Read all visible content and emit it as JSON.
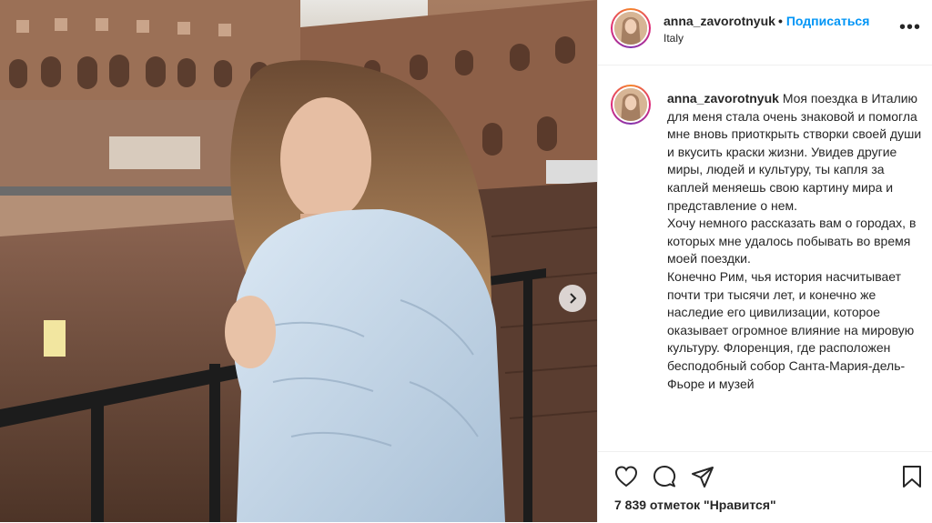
{
  "post": {
    "username": "anna_zavorotnyuk",
    "follow_label": "Подписаться",
    "separator": "•",
    "location": "Italy",
    "more_label": "•••"
  },
  "caption": {
    "username": "anna_zavorotnyuk",
    "text": "Моя поездка в Италию для меня стала очень знаковой и помогла мне вновь приоткрыть створки своей души и вкусить краски жизни. Увидев другие миры, людей и культуру, ты капля за каплей меняешь свою картину мира и представление о нем.\nХочу немного рассказать вам о городах, в которых мне удалось побывать во время моей поездки.\nКонечно Рим, чья история насчитывает почти три тысячи лет, и конечно же наследие его цивилизации, которое оказывает огромное влияние на мировую культуру. Флоренция, где расположен бесподобный собор Санта-Мария-дель-Фьоре и музей"
  },
  "actions": {
    "icons": [
      "heart-icon",
      "comment-icon",
      "share-icon",
      "bookmark-icon"
    ],
    "likes_text": "7 839 отметок \"Нравится\""
  },
  "colors": {
    "follow": "#0095f6",
    "text": "#262626",
    "border": "#efefef"
  }
}
